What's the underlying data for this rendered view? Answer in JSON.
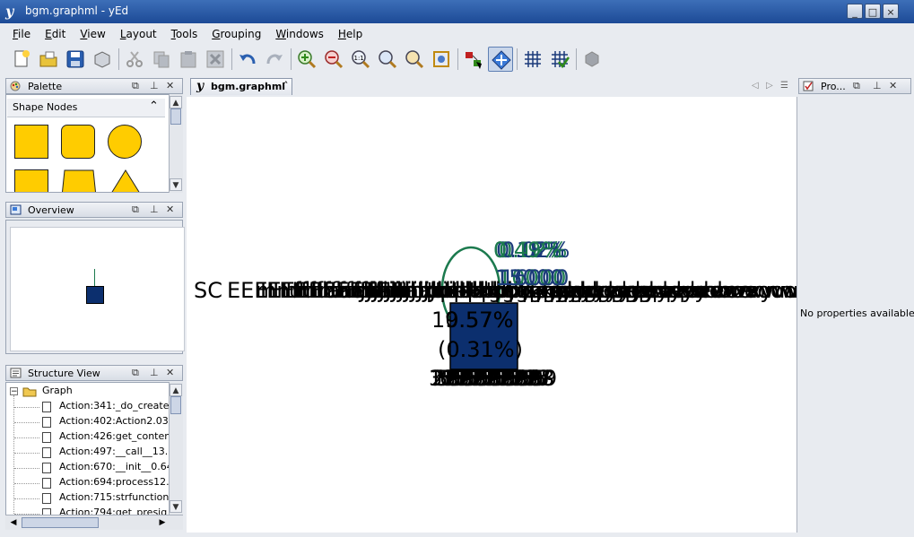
{
  "window": {
    "title": "bgm.graphml - yEd",
    "logo": "y",
    "controls": [
      "_",
      "□",
      "×"
    ]
  },
  "menubar": [
    "File",
    "Edit",
    "View",
    "Layout",
    "Tools",
    "Grouping",
    "Windows",
    "Help"
  ],
  "menubar_mnemonics": [
    "F",
    "E",
    "V",
    "L",
    "T",
    "G",
    "W",
    "H"
  ],
  "toolbar": {
    "icons": [
      "new-document-icon",
      "open-folder-icon",
      "save-icon",
      "properties-box-icon",
      "cut-icon",
      "copy-icon",
      "paste-icon",
      "delete-icon",
      "undo-icon",
      "redo-icon",
      "zoom-in-icon",
      "zoom-out-icon",
      "zoom-actual-icon",
      "zoom-icon",
      "zoom-area-icon",
      "fit-content-icon",
      "create-edge-mode-icon",
      "navigate-mode-icon",
      "grid-icon",
      "snap-grid-icon",
      "plugin-icon"
    ],
    "zoom_actual_text": "1:1"
  },
  "palette": {
    "title": "Palette",
    "section": "Shape Nodes",
    "colors": {
      "shape_fill": "#ffcc00",
      "shape_border": "#222222"
    }
  },
  "overview": {
    "title": "Overview"
  },
  "structure": {
    "title": "Structure View",
    "root": "Graph",
    "items": [
      "Action:341:_do_create",
      "Action:402:Action2.039",
      "Action:426:get_conten",
      "Action:497:__call__13.",
      "Action:670:__init__0.64",
      "Action:694:process12.",
      "Action:715:strfunction",
      "Action:794:get_presig"
    ]
  },
  "document": {
    "tab_label": "bgm.graphml",
    "tab_marker": "˄"
  },
  "canvas": {
    "left_label": "SC",
    "right_label": "xy",
    "mid_labels": [
      "E",
      "I",
      "f",
      "a",
      "J",
      "t",
      "p",
      "l",
      "c",
      "s",
      "d",
      "e",
      "r",
      "v",
      "o",
      "n",
      "m",
      "u",
      "b",
      "h",
      "i",
      "x",
      "k",
      "g",
      "q",
      "y",
      "w",
      "z"
    ],
    "percent_line": "10.57%",
    "percent_overlay": "9.57%",
    "percent_inner": "(0.31%)",
    "count_line": "3",
    "count_overlays": [
      "1",
      "2",
      "3",
      "5",
      "6",
      "7",
      "8",
      "9"
    ],
    "edge_top_label": "0.49%",
    "edge_top_overlays": [
      "0.41%",
      "0.18%",
      "0.12%",
      "0.02%"
    ],
    "edge_bottom_label": "15000",
    "edge_bottom_overlays": [
      "13000",
      "10000",
      "16000"
    ],
    "colors": {
      "node_fill": "#0c2f6e",
      "node_border": "#000000",
      "edge_green": "#1c7a4e",
      "edge_navy": "#1b3b7a",
      "text": "#000000"
    }
  },
  "properties": {
    "title": "Pro...",
    "empty_text": "No properties available"
  }
}
